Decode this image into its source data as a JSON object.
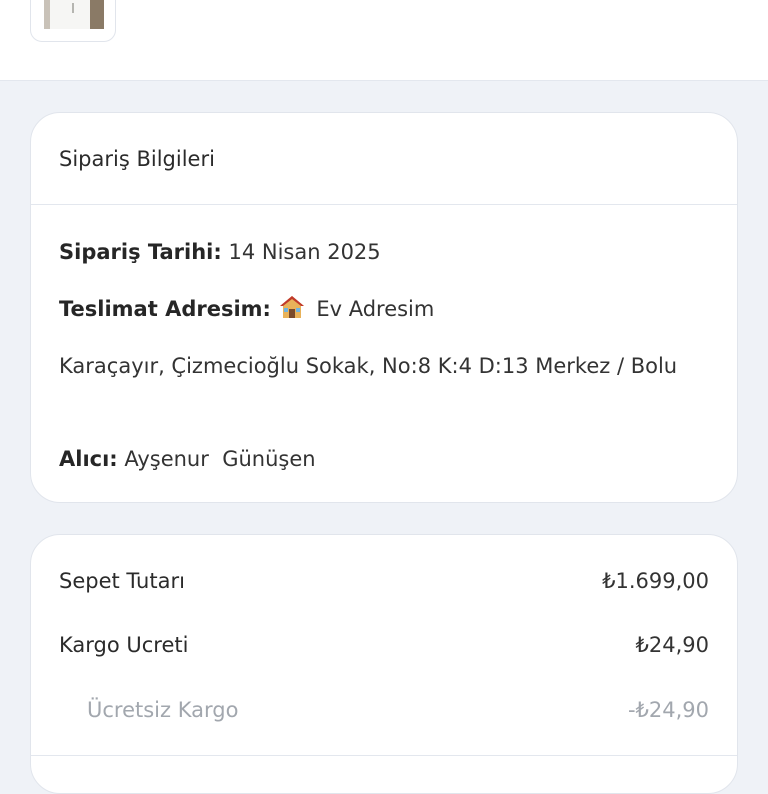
{
  "order_info": {
    "title": "Sipariş Bilgileri",
    "date_label": "Sipariş Tarihi:",
    "date_value": "14 Nisan 2025",
    "address_label": "Teslimat Adresim:",
    "address_icon": "house-icon",
    "address_name": "Ev Adresim",
    "address_text": "Karaçayır, Çizmecioğlu Sokak, No:8 K:4 D:13 Merkez / Bolu",
    "recipient_label": "Alıcı:",
    "recipient_value": "Ayşenur  Günüşen"
  },
  "summary": {
    "rows": [
      {
        "label": "Sepet Tutarı",
        "amount": "₺1.699,00"
      },
      {
        "label": "Kargo Ucreti",
        "amount": "₺24,90"
      },
      {
        "label": "Ücretsiz Kargo",
        "amount": "-₺24,90"
      }
    ]
  },
  "colors": {
    "background": "#eff2f7",
    "card": "#ffffff",
    "muted_text": "#a2a7ae"
  }
}
